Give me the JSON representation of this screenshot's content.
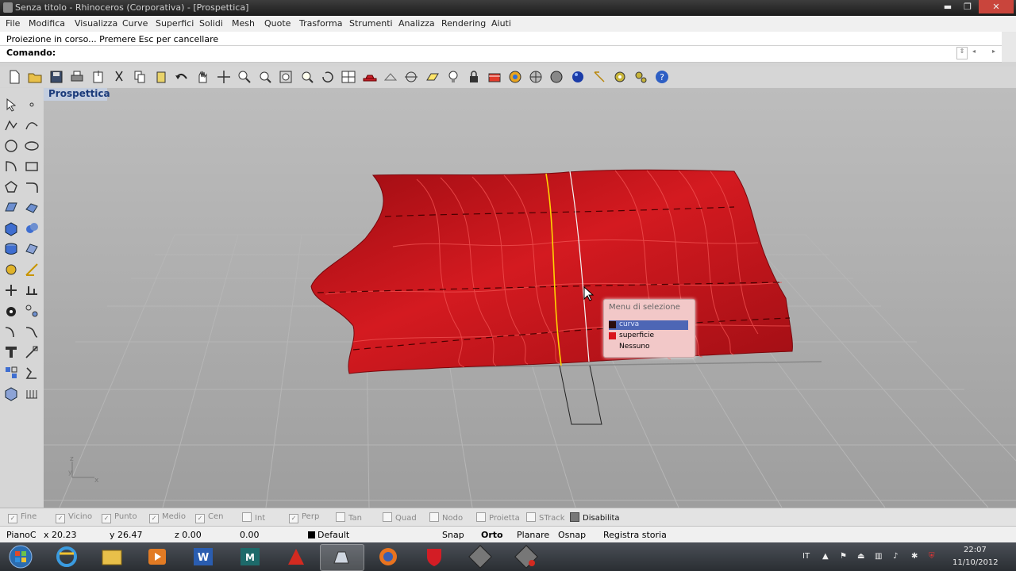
{
  "window": {
    "title": "Senza titolo - Rhinoceros (Corporativa) - [Prospettica]",
    "min": "▬",
    "max": "❐",
    "close": "✕"
  },
  "menu": [
    "File",
    "Modifica",
    "Visualizza",
    "Curve",
    "Superfici",
    "Solidi",
    "Mesh",
    "Quote",
    "Trasforma",
    "Strumenti",
    "Analizza",
    "Rendering",
    "Aiuti"
  ],
  "command": {
    "history": "Proiezione in corso... Premere Esc per cancellare",
    "prompt": "Comando:"
  },
  "viewport": {
    "label": "Prospettica",
    "surface_color": "#c0101a",
    "axis_z": "z",
    "axis_x": "x",
    "axis_y": "y"
  },
  "selection_menu": {
    "title": "Menu di selezione",
    "items": [
      {
        "label": "curva",
        "color": "#2a0d0d",
        "selected": true
      },
      {
        "label": "superficie",
        "color": "#d9141c",
        "selected": false
      },
      {
        "label": "Nessuno",
        "color": "",
        "selected": false
      }
    ]
  },
  "osnap": [
    {
      "label": "Fine",
      "checked": true
    },
    {
      "label": "Vicino",
      "checked": true
    },
    {
      "label": "Punto",
      "checked": true
    },
    {
      "label": "Medio",
      "checked": true
    },
    {
      "label": "Cen",
      "checked": true
    },
    {
      "label": "Int",
      "checked": false
    },
    {
      "label": "Perp",
      "checked": true
    },
    {
      "label": "Tan",
      "checked": false
    },
    {
      "label": "Quad",
      "checked": false
    },
    {
      "label": "Nodo",
      "checked": false
    },
    {
      "label": "Proietta",
      "checked": false
    },
    {
      "label": "STrack",
      "checked": false
    },
    {
      "label": "Disabilita",
      "checked": false
    }
  ],
  "status": {
    "cplane": "PianoC",
    "x": "x 20.23",
    "y": "y 26.47",
    "z": "z 0.00",
    "dist": "0.00",
    "layer": "Default",
    "snap": "Snap",
    "ortho": "Orto",
    "planar": "Planare",
    "osnap": "Osnap",
    "history": "Registra storia"
  },
  "taskbar": {
    "lang": "IT",
    "time": "22:07",
    "date": "11/10/2012"
  },
  "toolbar_icons": [
    "new-icon",
    "open-icon",
    "save-icon",
    "print-icon",
    "import-icon",
    "cut-icon",
    "copy-icon",
    "paste-icon",
    "undo-icon",
    "pan-icon",
    "move-view-icon",
    "zoom-icon",
    "zoom-window-icon",
    "zoom-extents-icon",
    "zoom-selected-icon",
    "rotate-view-icon",
    "viewport-layout-icon",
    "car-icon",
    "wireframe-icon",
    "snap-icon",
    "cplane-icon",
    "light-icon",
    "lock-icon",
    "layer-icon",
    "color-wheel-icon",
    "shade-icon",
    "ghost-icon",
    "render-icon",
    "dimension-icon",
    "gear-icon",
    "options-icon",
    "help-icon"
  ],
  "left_icons": [
    "select-icon",
    "point-icon",
    "polyline-icon",
    "curve-pt-icon",
    "circle-icon",
    "ellipse-icon",
    "arc-icon",
    "rectangle-icon",
    "polygon-icon",
    "fillet-icon",
    "surface-pt-icon",
    "surface-edge-icon",
    "box-icon",
    "solid-union-icon",
    "extrude-icon",
    "mesh-icon",
    "transform-icon",
    "dimension-tool-icon",
    "move-icon",
    "align-icon",
    "group-icon",
    "array-icon",
    "bend-icon",
    "blend-icon",
    "text-icon",
    "scale-icon",
    "boolean-icon",
    "flow-icon",
    "analyze-icon",
    "grid-icon"
  ]
}
